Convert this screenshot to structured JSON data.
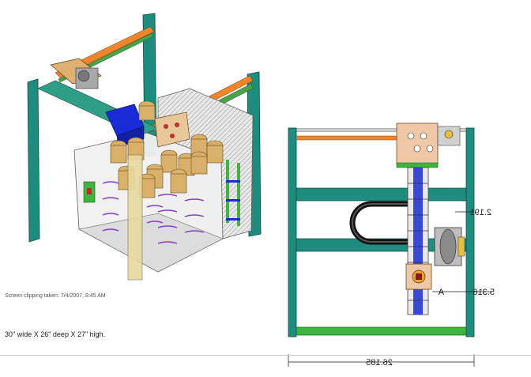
{
  "captions": {
    "clipping": "Screen clipping taken: 7/4/2007, 8:45 AM",
    "size": "30\" wide X 26\" deep X 27\" high."
  },
  "dimensions": {
    "top_right": "2.191",
    "mid_right": "5.316",
    "bottom_width": "26.185",
    "letter": "A"
  },
  "colors": {
    "frame": "#1f8c80",
    "rail_orange": "#f0852a",
    "rail_green": "#4aa24a",
    "motor_blue": "#1a2ad8",
    "canister": "#d9b06a",
    "coil": "#8a3cc8",
    "base_green": "#3fb53f"
  }
}
